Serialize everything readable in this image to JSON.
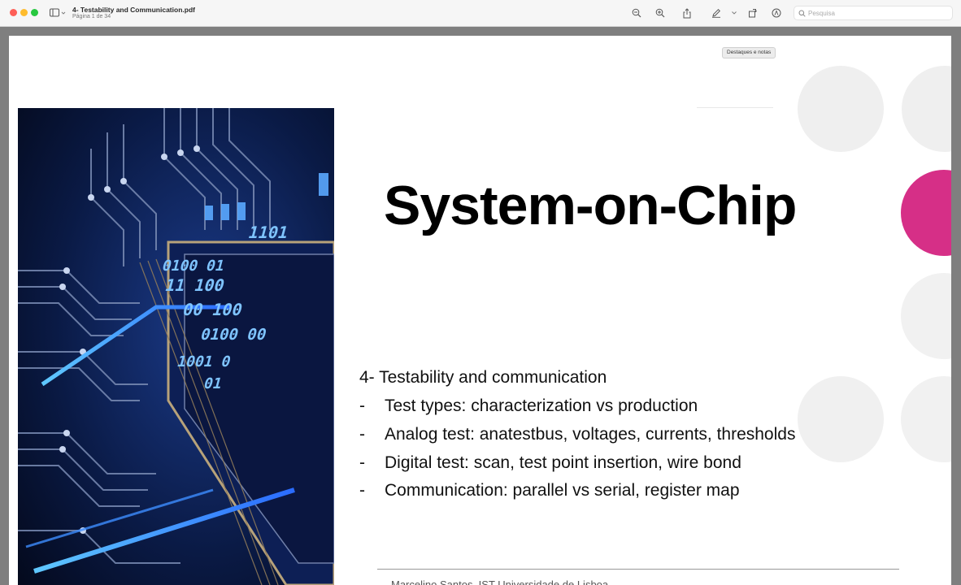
{
  "window": {
    "title": "4- Testability and Communication.pdf",
    "subtitle": "Página 1 de 34"
  },
  "toolbar": {
    "search_placeholder": "Pesquisa",
    "tooltip": "Destaques e notas"
  },
  "slide": {
    "title": "System-on-Chip",
    "subtitle": "4- Testability and communication",
    "bullets": [
      {
        "dash": "-",
        "text": "Test types: characterization vs production"
      },
      {
        "dash": "-",
        "text": "Analog test: anatestbus, voltages, currents, thresholds"
      },
      {
        "dash": "-",
        "text": "Digital test: scan, test point insertion, wire bond"
      },
      {
        "dash": "-",
        "text": "Communication: parallel vs serial, register map"
      }
    ],
    "footer": "Marcelino Santos, IST Universidade de Lisboa"
  },
  "chip_binary": [
    "1101",
    "0100 01",
    "11 100",
    "00 100",
    "0100 00",
    "1001 0",
    "01"
  ],
  "colors": {
    "accent_magenta": "#d62f87",
    "deco_gray": "#efefef",
    "circuit_blue": "#2a6bff"
  }
}
